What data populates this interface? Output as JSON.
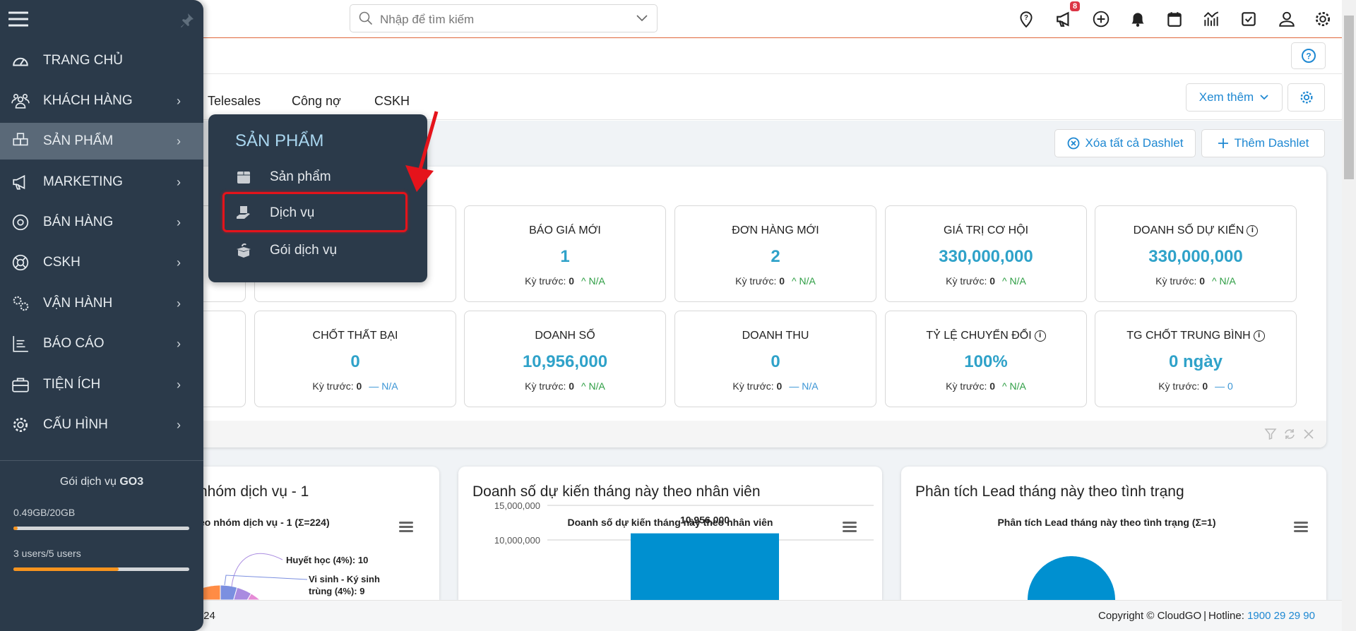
{
  "header": {
    "search_placeholder": "Nhập để tìm kiếm",
    "icons": [
      "location-help-icon",
      "megaphone-icon",
      "plus-circle-icon",
      "bell-icon",
      "calendar-icon",
      "chart-icon",
      "checkbox-icon",
      "user-icon",
      "gear-icon"
    ],
    "notification_count": "8"
  },
  "tabs": [
    {
      "label": "Telesales"
    },
    {
      "label": "Công nợ"
    },
    {
      "label": "CSKH"
    }
  ],
  "toolbar": {
    "more_label": "Xem thêm",
    "clear_dashlets": "Xóa tất cả Dashlet",
    "add_dashlet": "Thêm Dashlet"
  },
  "stats": {
    "row1": [
      {
        "label": "",
        "value": "",
        "prev_label": "",
        "prev_value": "",
        "trend": "",
        "change": ""
      },
      {
        "label": "",
        "value": "",
        "prev_label": "",
        "prev_value": "",
        "trend": "",
        "change": ""
      },
      {
        "label": "BÁO GIÁ MỚI",
        "value": "1",
        "prev_label": "Kỳ trước:",
        "prev_value": "0",
        "trend": "up",
        "change": "N/A"
      },
      {
        "label": "ĐƠN HÀNG MỚI",
        "value": "2",
        "prev_label": "Kỳ trước:",
        "prev_value": "0",
        "trend": "up",
        "change": "N/A"
      },
      {
        "label": "GIÁ TRỊ CƠ HỘI",
        "value": "330,000,000",
        "prev_label": "Kỳ trước:",
        "prev_value": "0",
        "trend": "up",
        "change": "N/A"
      },
      {
        "label": "DOANH SỐ DỰ KIẾN",
        "value": "330,000,000",
        "prev_label": "Kỳ trước:",
        "prev_value": "0",
        "trend": "up",
        "change": "N/A",
        "info": true
      }
    ],
    "row2": [
      {
        "label": "",
        "value": "",
        "prev_label": "",
        "prev_value": "",
        "trend": "",
        "change": ""
      },
      {
        "label": "CHỐT THẤT BẠI",
        "value": "0",
        "prev_label": "Kỳ trước:",
        "prev_value": "0",
        "trend": "flat",
        "change": "N/A"
      },
      {
        "label": "DOANH SỐ",
        "value": "10,956,000",
        "prev_label": "Kỳ trước:",
        "prev_value": "0",
        "trend": "up",
        "change": "N/A"
      },
      {
        "label": "DOANH THU",
        "value": "0",
        "prev_label": "Kỳ trước:",
        "prev_value": "0",
        "trend": "flat",
        "change": "N/A"
      },
      {
        "label": "TỶ LỆ CHUYỂN ĐỔI",
        "value": "100%",
        "prev_label": "Kỳ trước:",
        "prev_value": "0",
        "trend": "up",
        "change": "N/A",
        "info": true
      },
      {
        "label": "TG CHỐT TRUNG BÌNH",
        "value": "0 ngày",
        "prev_label": "Kỳ trước:",
        "prev_value": "0",
        "trend": "flat",
        "change": "0",
        "info": true
      }
    ]
  },
  "chart_data": [
    {
      "type": "pie",
      "panel_title": "nhóm dịch vụ - 1",
      "title": "eo nhóm dịch vụ - 1 (Σ=224)",
      "slices": [
        {
          "label": "Huyết học (4%): 10",
          "value": 10,
          "color": "#7b8fe0"
        },
        {
          "label": "Vi sinh - Ký sinh trùng (4%): 9",
          "value": 9,
          "color": "#a98be0"
        }
      ],
      "label_lines": [
        "Huyết học (4%): 10",
        "Vi sinh - Ký sinh",
        "trùng (4%): 9"
      ]
    },
    {
      "type": "bar",
      "panel_title": "Doanh số dự kiến tháng này theo nhân viên",
      "title": "Doanh số dự kiến tháng này theo nhân viên",
      "yticks": [
        "15,000,000",
        "10,000,000"
      ],
      "ytick_values": [
        15000000,
        10000000
      ],
      "values": [
        10956000
      ],
      "data_labels": [
        "10,956,000"
      ],
      "color": "#0090d0",
      "grid": true
    },
    {
      "type": "pie",
      "panel_title": "Phân tích Lead tháng này theo tình trạng",
      "title": "Phân tích Lead tháng này theo tình trạng (Σ=1)",
      "slices": [
        {
          "value": 1,
          "color": "#0090d0"
        }
      ]
    }
  ],
  "footer": {
    "left_fragment": "/24",
    "copyright": "Copyright © CloudGO",
    "hotline_label": "Hotline:",
    "hotline": "1900 29 29 90"
  },
  "sidebar": {
    "items": [
      {
        "label": "TRANG CHỦ",
        "icon": "dashboard-icon",
        "submenu": false
      },
      {
        "label": "KHÁCH HÀNG",
        "icon": "users-icon",
        "submenu": true
      },
      {
        "label": "SẢN PHẨM",
        "icon": "boxes-icon",
        "submenu": true,
        "active": true
      },
      {
        "label": "MARKETING",
        "icon": "megaphone-icon",
        "submenu": true
      },
      {
        "label": "BÁN HÀNG",
        "icon": "target-icon",
        "submenu": true
      },
      {
        "label": "CSKH",
        "icon": "lifebuoy-icon",
        "submenu": true
      },
      {
        "label": "VẬN HÀNH",
        "icon": "gears-icon",
        "submenu": true
      },
      {
        "label": "BÁO CÁO",
        "icon": "report-icon",
        "submenu": true
      },
      {
        "label": "TIỆN ÍCH",
        "icon": "toolbox-icon",
        "submenu": true
      },
      {
        "label": "CẤU HÌNH",
        "icon": "gear-icon",
        "submenu": true
      }
    ],
    "plan_label": "Gói dịch vụ",
    "plan_name": "GO3",
    "storage": "0.49GB/20GB",
    "storage_percent": 2.45,
    "users": "3 users/5 users",
    "users_percent": 60,
    "accent": "#f7931e"
  },
  "popover": {
    "title": "SẢN PHẨM",
    "items": [
      {
        "label": "Sản phẩm",
        "icon": "box-icon"
      },
      {
        "label": "Dịch vụ",
        "icon": "service-hand-icon",
        "highlighted": true
      },
      {
        "label": "Gói dịch vụ",
        "icon": "package-open-icon"
      }
    ]
  }
}
